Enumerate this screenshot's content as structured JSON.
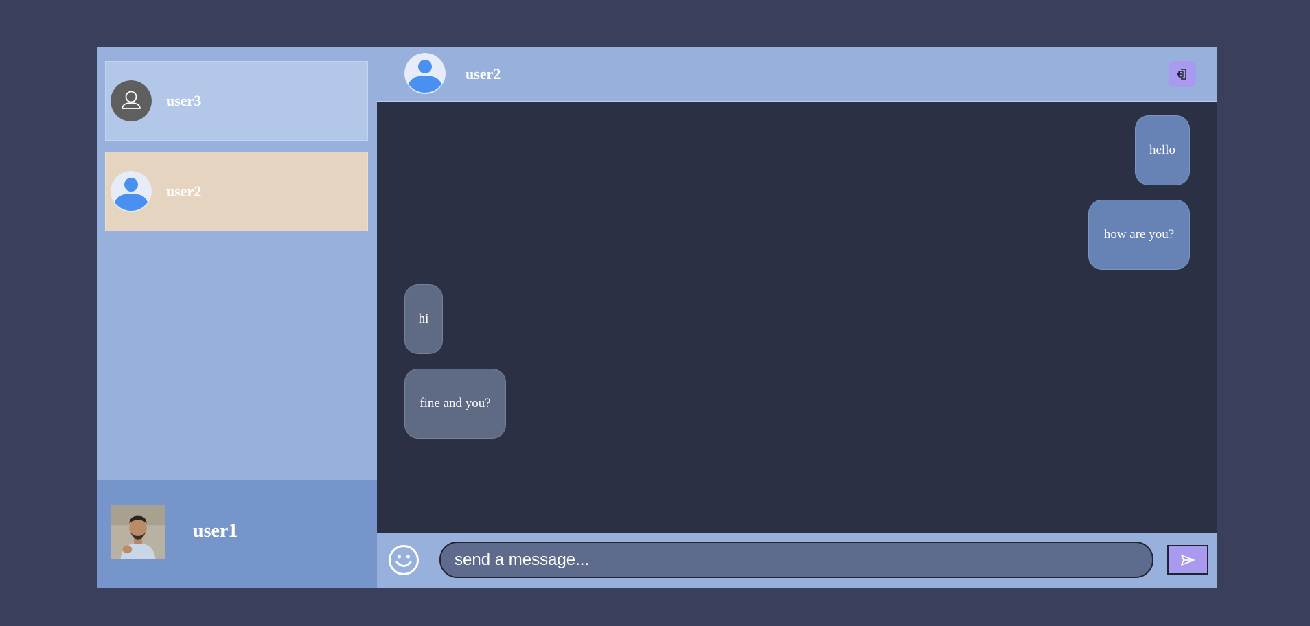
{
  "sidebar": {
    "contacts": [
      {
        "name": "user3",
        "avatar": "default-user-icon"
      },
      {
        "name": "user2",
        "avatar": "blue-person-avatar"
      }
    ],
    "current_user": {
      "name": "user1",
      "avatar": "profile-photo"
    }
  },
  "chat": {
    "header": {
      "name": "user2",
      "logout_icon": "logout-icon"
    },
    "messages": [
      {
        "text": "hello",
        "direction": "out"
      },
      {
        "text": "how are you?",
        "direction": "out"
      },
      {
        "text": "hi",
        "direction": "in"
      },
      {
        "text": "fine and you?",
        "direction": "in"
      }
    ],
    "input": {
      "placeholder": "send a message...",
      "emoji_icon": "smiley-icon",
      "send_icon": "send-icon"
    }
  },
  "colors": {
    "background": "#3a405c",
    "sidebar": "#97b0dc",
    "contact_default": "#b3c7e9",
    "contact_selected": "#e5d4bf",
    "current_user_panel": "#7696cb",
    "chat_area": "#2b3045",
    "outgoing_bubble": "#6783b6",
    "incoming_bubble": "#5f6b85",
    "accent_button": "#a99af0"
  }
}
